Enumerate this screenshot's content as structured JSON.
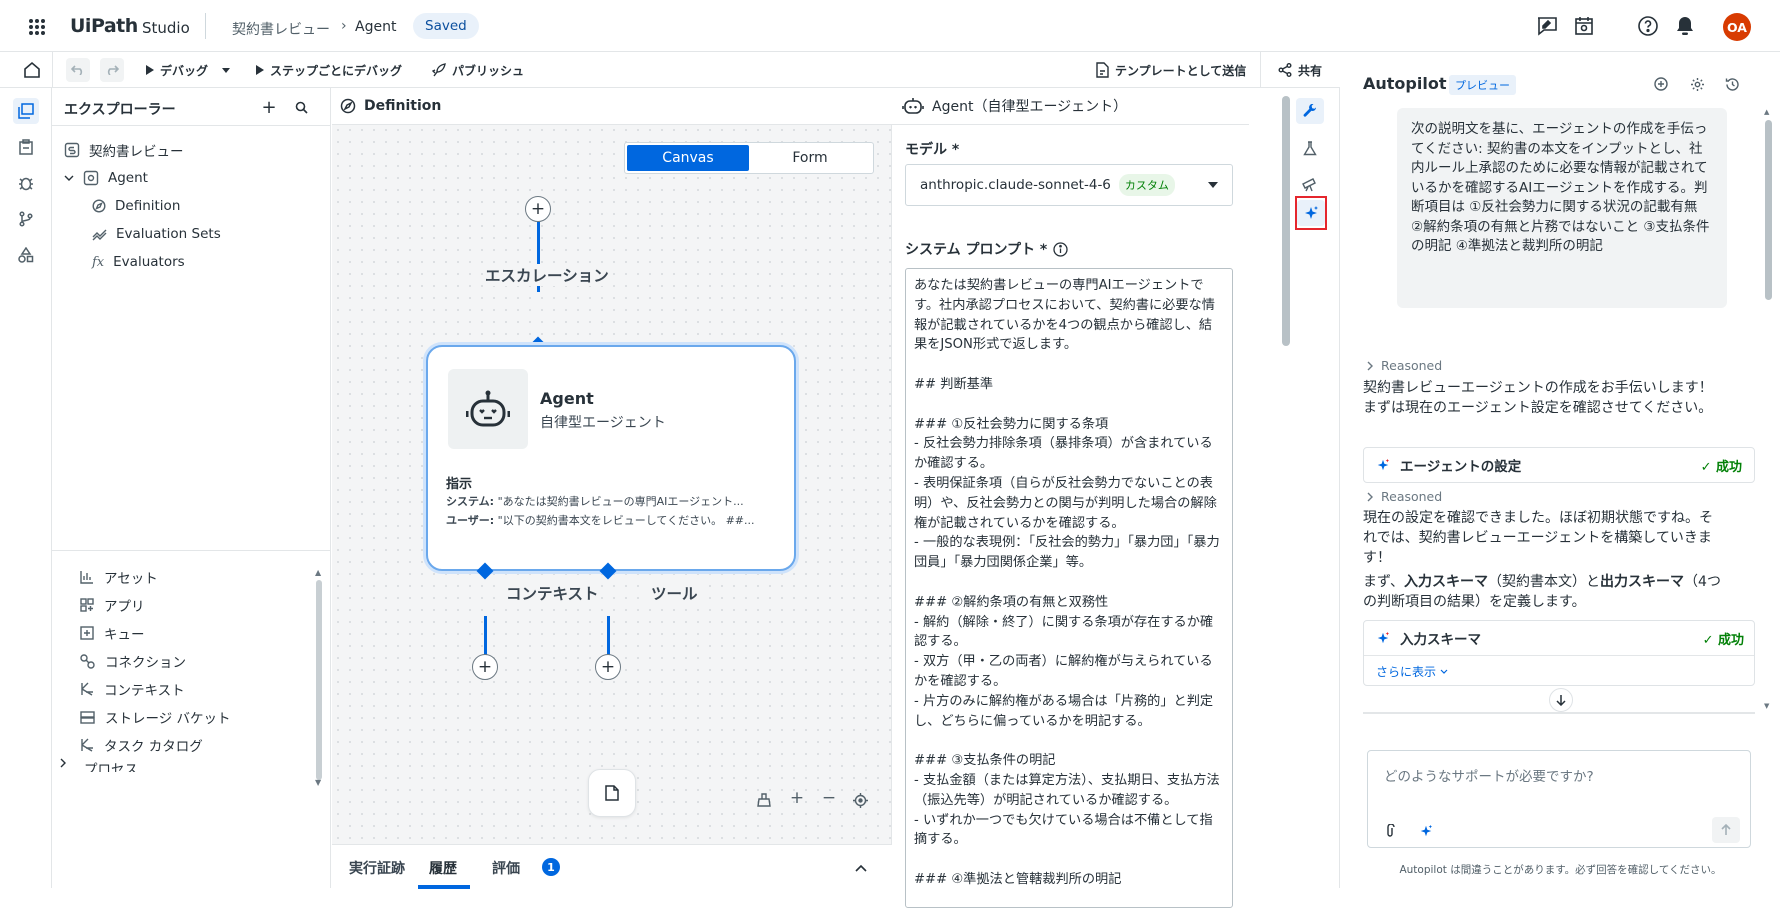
{
  "topbar": {
    "logo": "UiPath",
    "product": "Studio",
    "breadcrumb_project": "契約書レビュー",
    "breadcrumb_sep": "›",
    "breadcrumb_current": "Agent",
    "saved_badge": "Saved",
    "avatar": "OA"
  },
  "toolbar": {
    "debug": "デバッグ",
    "step_debug": "ステップごとにデバッグ",
    "publish": "パブリッシュ",
    "send_template": "テンプレートとして送信",
    "share": "共有"
  },
  "explorer": {
    "title": "エクスプローラー",
    "project": "契約書レビュー",
    "agent": "Agent",
    "items": [
      "Definition",
      "Evaluation Sets",
      "Evaluators"
    ],
    "resources": [
      "アセット",
      "アプリ",
      "キュー",
      "コネクション",
      "コンテキスト",
      "ストレージ バケット",
      "タスク カタログ",
      "プロセス"
    ]
  },
  "canvas": {
    "header": "Definition",
    "tab_canvas": "Canvas",
    "tab_form": "Form",
    "escalation": "エスカレーション",
    "context": "コンテキスト",
    "tools": "ツール",
    "agent_title": "Agent",
    "agent_sub": "自律型エージェント",
    "instructions": "指示",
    "sys_label": "システム:",
    "sys_text": " \"あなたは契約書レビューの専門AIエージェント...",
    "user_label": "ユーザー:",
    "user_text": " \"以下の契約書本文をレビューしてください。 ##...",
    "bottom_tabs": [
      "実行証跡",
      "履歴",
      "評価"
    ],
    "eval_count": "1"
  },
  "config": {
    "header": "Agent（自律型エージェント）",
    "model_label": "モデル *",
    "model_value": "anthropic.claude-sonnet-4-6",
    "model_badge": "カスタム",
    "prompt_label": "システム プロンプト *",
    "prompt": "あなたは契約書レビューの専門AIエージェントです。社内承認プロセスにおいて、契約書に必要な情報が記載されているかを4つの観点から確認し、結果をJSON形式で返します。\n\n## 判断基準\n\n### ①反社会勢力に関する条項\n- 反社会勢力排除条項（暴排条項）が含まれているか確認する。\n- 表明保証条項（自らが反社会勢力でないことの表明）や、反社会勢力との関与が判明した場合の解除権が記載されているかを確認する。\n- 一般的な表現例：「反社会的勢力」「暴力団」「暴力団員」「暴力団関係企業」等。\n\n### ②解約条項の有無と双務性\n- 解約（解除・終了）に関する条項が存在するか確認する。\n- 双方（甲・乙の両者）に解約権が与えられているかを確認する。\n- 片方のみに解約権がある場合は「片務的」と判定し、どちらに偏っているかを明記する。\n\n### ③支払条件の明記\n- 支払金額（または算定方法）、支払期日、支払方法（振込先等）が明記されているか確認する。\n- いずれか一つでも欠けている場合は不備として指摘する。\n\n### ④準拠法と管轄裁判所の明記"
  },
  "autopilot": {
    "title": "Autopilot",
    "badge": "プレビュー",
    "user_msg": "次の説明文を基に、エージェントの作成を手伝ってください: 契約書の本文をインプットとし、社内ルール上承認のために必要な情報が記載されているかを確認するAIエージェントを作成する。判断項目は ①反社会勢力に関する状況の記載有無 ②解約条項の有無と片務ではないこと ③支払条件の明記 ④準拠法と裁判所の明記",
    "reasoned": "Reasoned",
    "msg1": "契約書レビューエージェントの作成をお手伝いします！まずは現在のエージェント設定を確認させてください。",
    "card1_title": "エージェントの設定",
    "success": "成功",
    "msg2": "現在の設定を確認できました。ほぼ初期状態ですね。それでは、契約書レビューエージェントを構築していきます！",
    "msg3_a": "まず、",
    "msg3_b": "入力スキーマ",
    "msg3_c": "（契約書本文）と",
    "msg3_d": "出力スキーマ",
    "msg3_e": "（4つの判断項目の結果）を定義します。",
    "card2_title": "入力スキーマ",
    "show_more": "さらに表示",
    "input_placeholder": "どのようなサポートが必要ですか?",
    "disclaimer": "Autopilot は間違うことがあります。必ず回答を確認してください。"
  },
  "colors": {
    "accent": "#0067df",
    "success": "#038108",
    "avatar_bg": "#d83b01",
    "highlight": "#e5262d"
  }
}
